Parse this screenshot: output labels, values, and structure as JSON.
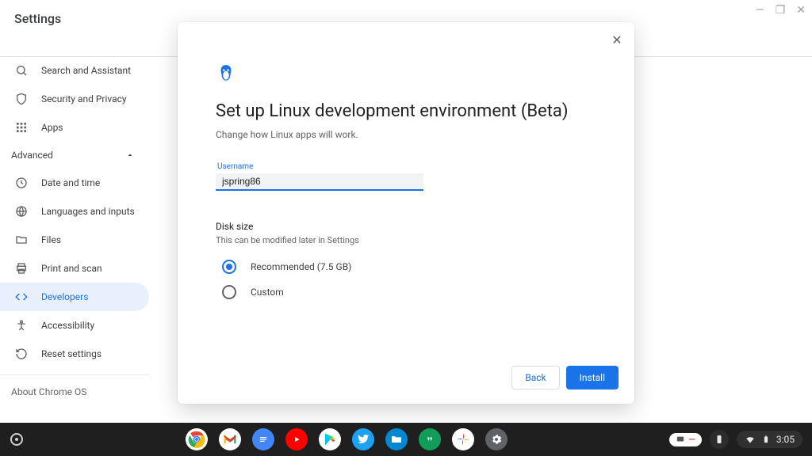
{
  "window": {
    "minimize": "_",
    "maximize": "▢",
    "close": "✕"
  },
  "header": {
    "title": "Settings"
  },
  "sidebar": {
    "advanced_label": "Advanced",
    "items_top": [
      {
        "label": "Search and Assistant"
      },
      {
        "label": "Security and Privacy"
      },
      {
        "label": "Apps"
      }
    ],
    "items_adv": [
      {
        "label": "Date and time"
      },
      {
        "label": "Languages and inputs"
      },
      {
        "label": "Files"
      },
      {
        "label": "Print and scan"
      },
      {
        "label": "Developers"
      },
      {
        "label": "Accessibility"
      },
      {
        "label": "Reset settings"
      }
    ],
    "about": "About Chrome OS"
  },
  "modal": {
    "title": "Set up Linux development environment (Beta)",
    "subtitle": "Change how Linux apps will work.",
    "username_label": "Username",
    "username_value": "jspring86",
    "disk_title": "Disk size",
    "disk_sub": "This can be modified later in Settings",
    "option_recommended": "Recommended (7.5 GB)",
    "option_custom": "Custom",
    "back": "Back",
    "install": "Install"
  },
  "shelf": {
    "time": "3:05"
  }
}
